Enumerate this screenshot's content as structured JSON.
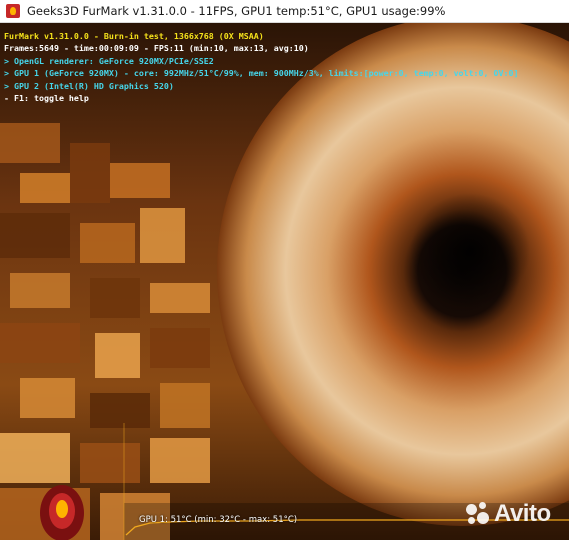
{
  "window": {
    "title": "Geeks3D FurMark v1.31.0.0 - 11FPS, GPU1 temp:51°C, GPU1 usage:99%",
    "icon": "furmark-app-icon"
  },
  "hud": {
    "line1": "FurMark v1.31.0.0 - Burn-in test, 1366x768 (0X MSAA)",
    "line2": "Frames:5649 - time:00:09:09 - FPS:11 (min:10, max:13, avg:10)",
    "line3": "> OpenGL renderer: GeForce 920MX/PCIe/SSE2",
    "line4": "> GPU 1 (GeForce 920MX) - core: 992MHz/51°C/99%, mem: 900MHz/3%, limits:[power:0, temp:0, volt:0, OV:0]",
    "line5": "> GPU 2 (Intel(R) HD Graphics 520)",
    "line6": "- F1: toggle help"
  },
  "temp_graph": {
    "label": "GPU 1: 51°C (min: 32°C - max: 51°C)",
    "line_color": "#f0a81e"
  },
  "watermark": {
    "text": "Avito"
  },
  "colors": {
    "hud_yellow": "#f5e21b",
    "hud_cyan": "#46d6ea",
    "hud_white": "#ffffff"
  }
}
